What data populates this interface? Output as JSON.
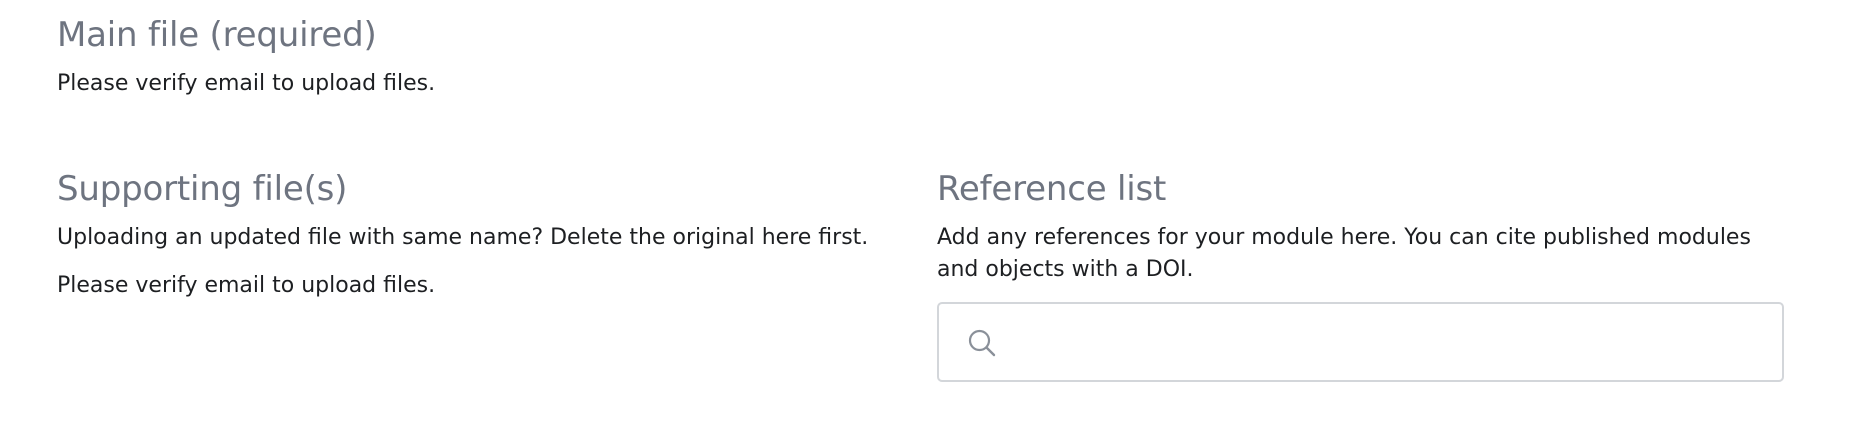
{
  "main_file": {
    "heading": "Main file (required)",
    "notice": "Please verify email to upload files."
  },
  "supporting_files": {
    "heading": "Supporting file(s)",
    "hint": "Uploading an updated file with same name? Delete the original here first.",
    "notice": "Please verify email to upload files."
  },
  "reference_list": {
    "heading": "Reference list",
    "description": "Add any references for your module here. You can cite published modules and objects with a DOI.",
    "search": {
      "icon": "search-icon",
      "value": "",
      "placeholder": ""
    }
  },
  "colors": {
    "heading": "#6e7480",
    "body_text": "#1d1f22",
    "input_border": "#d3d6da",
    "icon": "#8a9099"
  }
}
